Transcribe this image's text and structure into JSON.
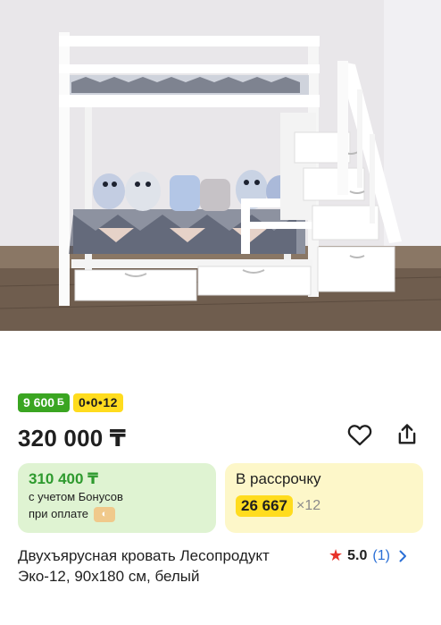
{
  "product": {
    "title": "Двухъярусная кровать Лесопродукт Эко-12, 90x180 см, белый",
    "price": "320 000 ₸"
  },
  "badges": {
    "bonus_amount": "9 600",
    "bonus_currency": "Б",
    "installment_code": "0•0•12"
  },
  "bonus_card": {
    "price": "310 400 ₸",
    "line1": "с учетом Бонусов",
    "line2": "при оплате"
  },
  "installment_card": {
    "title": "В рассрочку",
    "amount": "26 667",
    "times": "×12"
  },
  "rating": {
    "value": "5.0",
    "count": "(1)"
  },
  "colors": {
    "bonus_green": "#3aa521",
    "installment_yellow": "#ffdc1e",
    "bonus_card_bg": "#dff3d2",
    "installment_card_bg": "#fdf7c9",
    "rating_star": "#e8332a",
    "link_blue": "#2a6fd6"
  },
  "icons": {
    "favorite": "heart-icon",
    "share": "share-icon",
    "rating": "star-icon",
    "more": "chevron-right-icon",
    "payment": "kaspi-pay-icon"
  }
}
